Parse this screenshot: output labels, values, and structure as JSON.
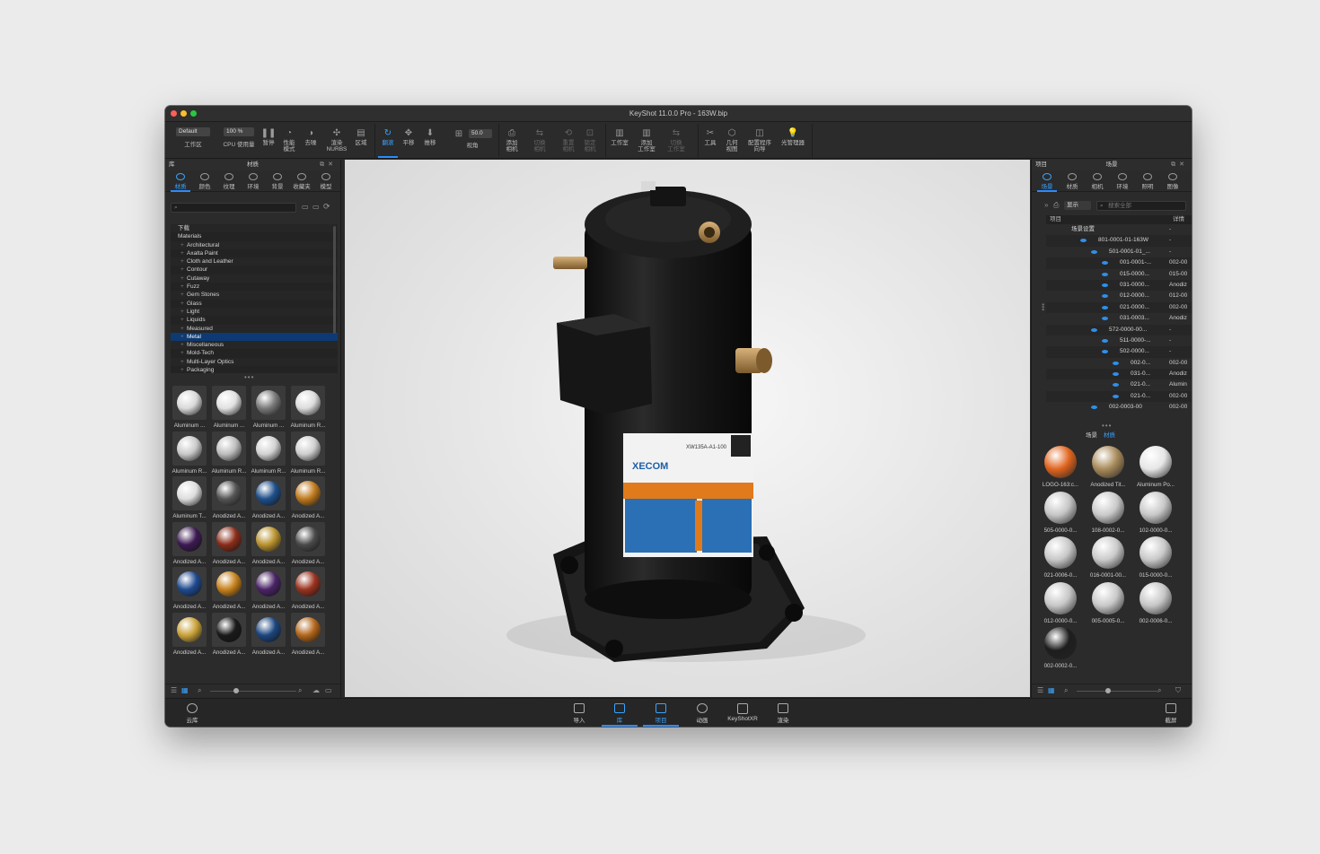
{
  "window": {
    "title": "KeyShot 11.0.0 Pro  - 163W.bip"
  },
  "toolbar": {
    "workspace_value": "Default",
    "workspace_label": "工作区",
    "cpu_value": "100 %",
    "cpu_label": "CPU 使用量",
    "pause_label": "暂停",
    "perf_label": "性能\n模式",
    "denoise_label": "去噪",
    "nurbs_label": "渲染\nNURBS",
    "region_label": "区域",
    "tumble_label": "翻滚",
    "pan_label": "平移",
    "push_label": "推移",
    "fov_value": "50.0",
    "fov_label": "视角",
    "add_camera_label": "添加\n相机",
    "switch_camera_label": "切换\n相机",
    "reset_camera_label": "重置\n相机",
    "lock_camera_label": "锁定\n相机",
    "studio_label": "工作室",
    "add_studio_label": "添加\n工作室",
    "switch_studio_label": "切换\n工作室",
    "tools_label": "工具",
    "geometry_view_label": "几何\n视图",
    "config_wizard_label": "配置程序\n向导",
    "light_manager_label": "光管理器"
  },
  "library": {
    "header_left": "库",
    "header_center": "材质",
    "tabs": [
      "材质",
      "颜色",
      "纹理",
      "环境",
      "背景",
      "收藏夹",
      "模型"
    ],
    "active_tab": "材质",
    "tree": [
      {
        "label": "下载",
        "top": true
      },
      {
        "label": "Materials",
        "top": true
      },
      {
        "label": "Architectural"
      },
      {
        "label": "Axalta Paint"
      },
      {
        "label": "Cloth and Leather"
      },
      {
        "label": "Contour"
      },
      {
        "label": "Cutaway"
      },
      {
        "label": "Fuzz"
      },
      {
        "label": "Gem Stones"
      },
      {
        "label": "Glass"
      },
      {
        "label": "Light"
      },
      {
        "label": "Liquids"
      },
      {
        "label": "Measured"
      },
      {
        "label": "Metal",
        "selected": true
      },
      {
        "label": "Miscellaneous"
      },
      {
        "label": "Mold-Tech"
      },
      {
        "label": "Multi-Layer Optics"
      },
      {
        "label": "Packaging"
      }
    ],
    "thumbnails": [
      {
        "caption": "Aluminum ...",
        "color": "#d9d9d9"
      },
      {
        "caption": "Aluminum ...",
        "color": "#e1e1e1"
      },
      {
        "caption": "Aluminum ...",
        "color": "#7a7a7a"
      },
      {
        "caption": "Aluminum R...",
        "color": "#dcdcdc"
      },
      {
        "caption": "Aluminum R...",
        "color": "#c9c9c9"
      },
      {
        "caption": "Aluminum R...",
        "color": "#bdbdbd"
      },
      {
        "caption": "Aluminum R...",
        "color": "#d2d2d2"
      },
      {
        "caption": "Aluminum R...",
        "color": "#cfcfcf"
      },
      {
        "caption": "Aluminum T...",
        "color": "#dedede"
      },
      {
        "caption": "Anodized A...",
        "color": "#555555"
      },
      {
        "caption": "Anodized A...",
        "color": "#1e4f8a"
      },
      {
        "caption": "Anodized A...",
        "color": "#c07a1e"
      },
      {
        "caption": "Anodized A...",
        "color": "#3c1a52"
      },
      {
        "caption": "Anodized A...",
        "color": "#8a2d1a"
      },
      {
        "caption": "Anodized A...",
        "color": "#b8922e"
      },
      {
        "caption": "Anodized A...",
        "color": "#4a4a4a"
      },
      {
        "caption": "Anodized A...",
        "color": "#1f4a8f"
      },
      {
        "caption": "Anodized A...",
        "color": "#c7821d"
      },
      {
        "caption": "Anodized A...",
        "color": "#4a2466"
      },
      {
        "caption": "Anodized A...",
        "color": "#9a3320"
      },
      {
        "caption": "Anodized A...",
        "color": "#c9a23a"
      },
      {
        "caption": "Anodized A...",
        "color": "#1a1a1a"
      },
      {
        "caption": "Anodized A...",
        "color": "#1c467f"
      },
      {
        "caption": "Anodized A...",
        "color": "#b3661b"
      }
    ]
  },
  "project": {
    "header_left": "项目",
    "header_center": "场景",
    "tabs": [
      "场景",
      "材质",
      "相机",
      "环境",
      "照明",
      "图像"
    ],
    "active_tab": "场景",
    "display_label": "显示",
    "search_placeholder": "搜索全部",
    "col_item": "项目",
    "col_detail": "详情",
    "scene_rows": [
      {
        "label": "场景设置",
        "detail": "-",
        "indent": 0,
        "eye": false
      },
      {
        "label": "801-0001-01-163W",
        "detail": "-",
        "indent": 1,
        "eye": true
      },
      {
        "label": "501-0001-01_...",
        "detail": "-",
        "indent": 2,
        "eye": true
      },
      {
        "label": "001-0001-...",
        "detail": "002-00",
        "indent": 3,
        "eye": true
      },
      {
        "label": "015-0000...",
        "detail": "015-00",
        "indent": 3,
        "eye": true
      },
      {
        "label": "031-0000...",
        "detail": "Anodiz",
        "indent": 3,
        "eye": true
      },
      {
        "label": "012-0000...",
        "detail": "012-00",
        "indent": 3,
        "eye": true
      },
      {
        "label": "021-0000...",
        "detail": "002-00",
        "indent": 3,
        "eye": true
      },
      {
        "label": "031-0003...",
        "detail": "Anodiz",
        "indent": 3,
        "eye": true
      },
      {
        "label": "572-0000-00...",
        "detail": "-",
        "indent": 2,
        "eye": true
      },
      {
        "label": "511-0000-...",
        "detail": "-",
        "indent": 3,
        "eye": true
      },
      {
        "label": "502-0000...",
        "detail": "-",
        "indent": 3,
        "eye": true
      },
      {
        "label": "002-0...",
        "detail": "002-00",
        "indent": 4,
        "eye": true
      },
      {
        "label": "031-0...",
        "detail": "Anodiz",
        "indent": 4,
        "eye": true
      },
      {
        "label": "021-0...",
        "detail": "Alumin",
        "indent": 4,
        "eye": true
      },
      {
        "label": "021-0...",
        "detail": "002-00",
        "indent": 4,
        "eye": true
      },
      {
        "label": "002-0003-00",
        "detail": "002-00",
        "indent": 2,
        "eye": true
      }
    ],
    "subtabs": [
      "场景",
      "材质"
    ],
    "active_subtab": "材质",
    "materials": [
      {
        "caption": "LOGO-163:c...",
        "color": "#e0641e"
      },
      {
        "caption": "Anodized Tit...",
        "color": "#a88a5a"
      },
      {
        "caption": "Aluminum Po...",
        "color": "#e6e6e6"
      },
      {
        "caption": "505-0000-0...",
        "color": "#c6c6c6"
      },
      {
        "caption": "108-0002-0...",
        "color": "#cacaca"
      },
      {
        "caption": "102-0000-0...",
        "color": "#c8c8c8"
      },
      {
        "caption": "021-0006-0...",
        "color": "#c8c8c8"
      },
      {
        "caption": "016-0001-00...",
        "color": "#cbcbcb"
      },
      {
        "caption": "015-0000-0...",
        "color": "#c9c9c9"
      },
      {
        "caption": "012-0000-0...",
        "color": "#c7c7c7"
      },
      {
        "caption": "005-0005-0...",
        "color": "#c9c9c9"
      },
      {
        "caption": "002-0006-0...",
        "color": "#c6c6c6"
      },
      {
        "caption": "002-0002-0...",
        "color": "#1e1e1e"
      }
    ]
  },
  "bottombar": {
    "cloud_label": "云库",
    "import_label": "导入",
    "library_label": "库",
    "project_label": "项目",
    "animation_label": "动画",
    "keyshotxr_label": "KeyShotXR",
    "render_label": "渲染",
    "screenshot_label": "截屏"
  },
  "product": {
    "brand": "XECOM",
    "model": "XW135A-A1-100"
  }
}
